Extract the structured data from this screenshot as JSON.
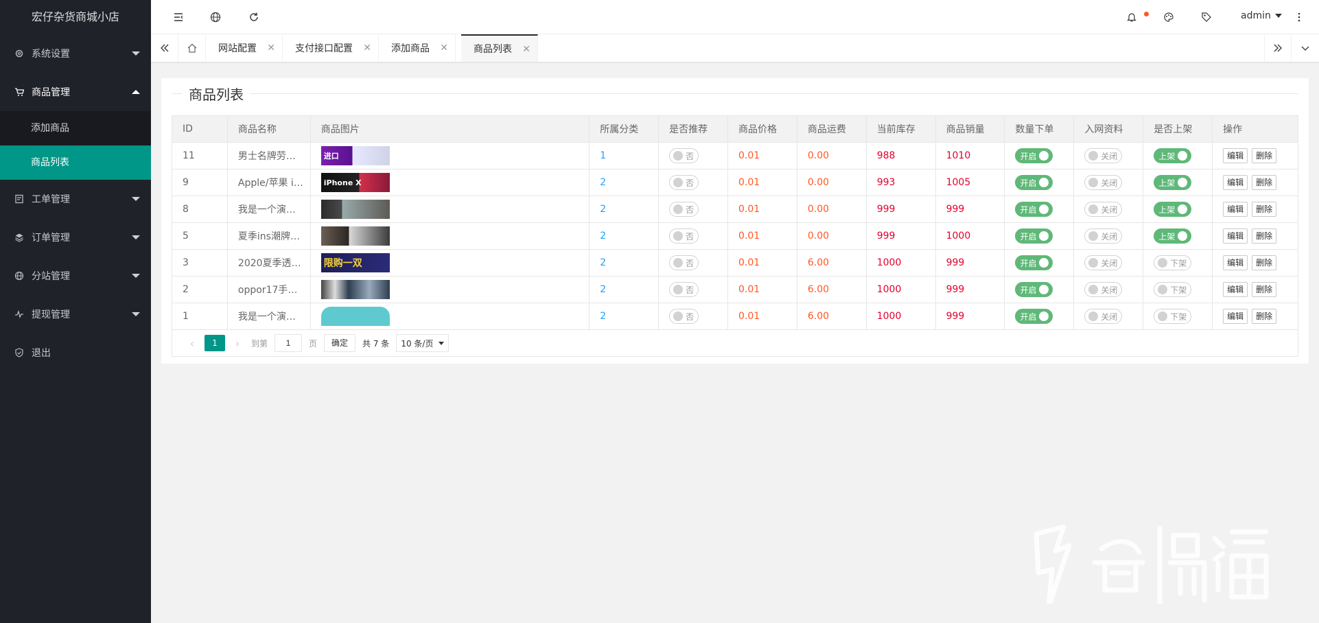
{
  "app": {
    "title": "宏仔杂货商城小店"
  },
  "sidebar": {
    "items": [
      {
        "label": "系统设置",
        "icon": "gear-icon"
      },
      {
        "label": "商品管理",
        "icon": "cart-icon"
      },
      {
        "label": "工单管理",
        "icon": "ticket-icon"
      },
      {
        "label": "订单管理",
        "icon": "layers-icon"
      },
      {
        "label": "分站管理",
        "icon": "globe-icon"
      },
      {
        "label": "提现管理",
        "icon": "pulse-icon"
      },
      {
        "label": "退出",
        "icon": "shield-icon"
      }
    ],
    "submenu": [
      "添加商品",
      "商品列表"
    ]
  },
  "header": {
    "user": "admin",
    "icons": [
      "menu-toggle-icon",
      "globe-icon",
      "refresh-icon",
      "bell-icon",
      "theme-icon",
      "tag-icon",
      "more-icon"
    ]
  },
  "tabs": [
    "网站配置",
    "支付接口配置",
    "添加商品",
    "商品列表"
  ],
  "card": {
    "title": "商品列表"
  },
  "table": {
    "headers": [
      "ID",
      "商品名称",
      "商品图片",
      "所属分类",
      "是否推荐",
      "商品价格",
      "商品运费",
      "当前库存",
      "商品销量",
      "数量下单",
      "入网资料",
      "是否上架",
      "操作"
    ],
    "rows": [
      {
        "id": "11",
        "name": "男士名牌劳…",
        "category": "1",
        "recommend": "否",
        "price": "0.01",
        "shipping": "0.00",
        "stock": "988",
        "sales": "1010",
        "qty": "开启",
        "netinfo": "关闭",
        "listed": "上架",
        "listed_on": true,
        "thumb_text": "进口"
      },
      {
        "id": "9",
        "name": "Apple/苹果 i…",
        "category": "2",
        "recommend": "否",
        "price": "0.01",
        "shipping": "0.00",
        "stock": "993",
        "sales": "1005",
        "qty": "开启",
        "netinfo": "关闭",
        "listed": "上架",
        "listed_on": true,
        "thumb_text": "iPhone X"
      },
      {
        "id": "8",
        "name": "我是一个演…",
        "category": "2",
        "recommend": "否",
        "price": "0.01",
        "shipping": "0.00",
        "stock": "999",
        "sales": "999",
        "qty": "开启",
        "netinfo": "关闭",
        "listed": "上架",
        "listed_on": true,
        "thumb_text": ""
      },
      {
        "id": "5",
        "name": "夏季ins潮牌…",
        "category": "2",
        "recommend": "否",
        "price": "0.01",
        "shipping": "0.00",
        "stock": "999",
        "sales": "1000",
        "qty": "开启",
        "netinfo": "关闭",
        "listed": "上架",
        "listed_on": true,
        "thumb_text": ""
      },
      {
        "id": "3",
        "name": "2020夏季透…",
        "category": "2",
        "recommend": "否",
        "price": "0.01",
        "shipping": "6.00",
        "stock": "1000",
        "sales": "999",
        "qty": "开启",
        "netinfo": "关闭",
        "listed": "下架",
        "listed_on": false,
        "thumb_text": "限购一双"
      },
      {
        "id": "2",
        "name": "oppor17手…",
        "category": "2",
        "recommend": "否",
        "price": "0.01",
        "shipping": "6.00",
        "stock": "1000",
        "sales": "999",
        "qty": "开启",
        "netinfo": "关闭",
        "listed": "下架",
        "listed_on": false,
        "thumb_text": ""
      },
      {
        "id": "1",
        "name": "我是一个演…",
        "category": "2",
        "recommend": "否",
        "price": "0.01",
        "shipping": "6.00",
        "stock": "1000",
        "sales": "999",
        "qty": "开启",
        "netinfo": "关闭",
        "listed": "下架",
        "listed_on": false,
        "thumb_text": ""
      }
    ],
    "actions": {
      "edit": "编辑",
      "delete": "删除"
    }
  },
  "pagination": {
    "current": "1",
    "goto_label": "到第",
    "goto_value": "1",
    "page_unit": "页",
    "confirm": "确定",
    "total": "共 7 条",
    "limit": "10 条/页"
  },
  "colors": {
    "sidebar_bg": "#20222a",
    "active": "#009688",
    "switch_on": "#5fb878",
    "price": "#ff5722",
    "stock": "#e4002b",
    "category": "#1e9fff"
  }
}
